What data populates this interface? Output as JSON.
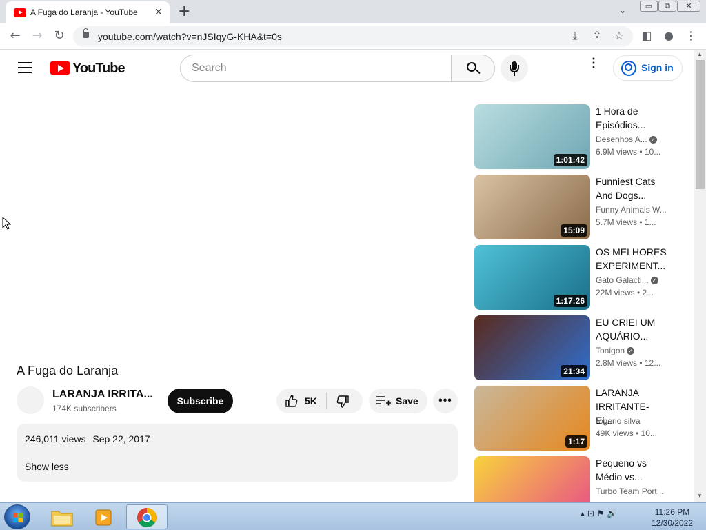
{
  "browser": {
    "tab_title": "A Fuga do Laranja - YouTube",
    "tab_close": "✕",
    "new_tab": "+",
    "tab_search": "⌄",
    "url": "youtube.com/watch?v=nJSIqyG-KHA&t=0s",
    "window_buttons": [
      "▭",
      "⧉",
      "✕"
    ]
  },
  "youtube": {
    "logo_text": "YouTube",
    "search_placeholder": "Search",
    "sign_in": "Sign in",
    "kebab": "⋮"
  },
  "video": {
    "title": "A Fuga do Laranja",
    "channel": "LARANJA IRRITA...",
    "subscribers": "174K subscribers",
    "subscribe_label": "Subscribe",
    "likes": "5K",
    "save_label": "Save",
    "more_label": "•••",
    "views": "246,011 views",
    "date": "Sep 22, 2017",
    "show_less": "Show less"
  },
  "recommendations": [
    {
      "title": "1 Hora de\nEpisódios...",
      "channel": "Desenhos A...",
      "verified": true,
      "stats": "6.9M views  • 10...",
      "duration": "1:01:42",
      "thumb_colors": [
        "#b9dde0",
        "#6fa7b3"
      ]
    },
    {
      "title": "Funniest Cats\nAnd Dogs...",
      "channel": "Funny Animals W...",
      "verified": false,
      "stats": "5.7M views  • 1...",
      "duration": "15:09",
      "thumb_colors": [
        "#d9c2a4",
        "#8a6b4a"
      ]
    },
    {
      "title": "OS MELHORES\nEXPERIMENT...",
      "channel": "Gato Galacti...",
      "verified": true,
      "stats": "22M views  • 2...",
      "duration": "1:17:26",
      "thumb_colors": [
        "#4fc2d8",
        "#1b6f8a"
      ]
    },
    {
      "title": "EU CRIEI UM\nAQUÁRIO...",
      "channel": "Tonigon",
      "verified": true,
      "stats": "2.8M views  • 12...",
      "duration": "21:34",
      "thumb_colors": [
        "#5a2a1e",
        "#2f6fd0"
      ]
    },
    {
      "title": "LARANJA\nIRRITANTE- Ei...",
      "channel": "rogerio silva",
      "verified": false,
      "stats": "49K views  • 10...",
      "duration": "1:17",
      "thumb_colors": [
        "#c9b79a",
        "#e6871d"
      ]
    },
    {
      "title": "Pequeno vs\nMédio vs...",
      "channel": "Turbo Team Port...",
      "verified": false,
      "stats": "",
      "duration": "",
      "thumb_colors": [
        "#f7d23c",
        "#e84c8a"
      ]
    }
  ],
  "taskbar": {
    "time": "11:26 PM",
    "date": "12/30/2022",
    "tray_icons": "▴  ⊡  ⚑  🔊"
  },
  "colors": {
    "yt_red": "#ff0000",
    "link_blue": "#065fd4",
    "dark": "#0f0f0f",
    "chip_bg": "#f2f2f2"
  }
}
